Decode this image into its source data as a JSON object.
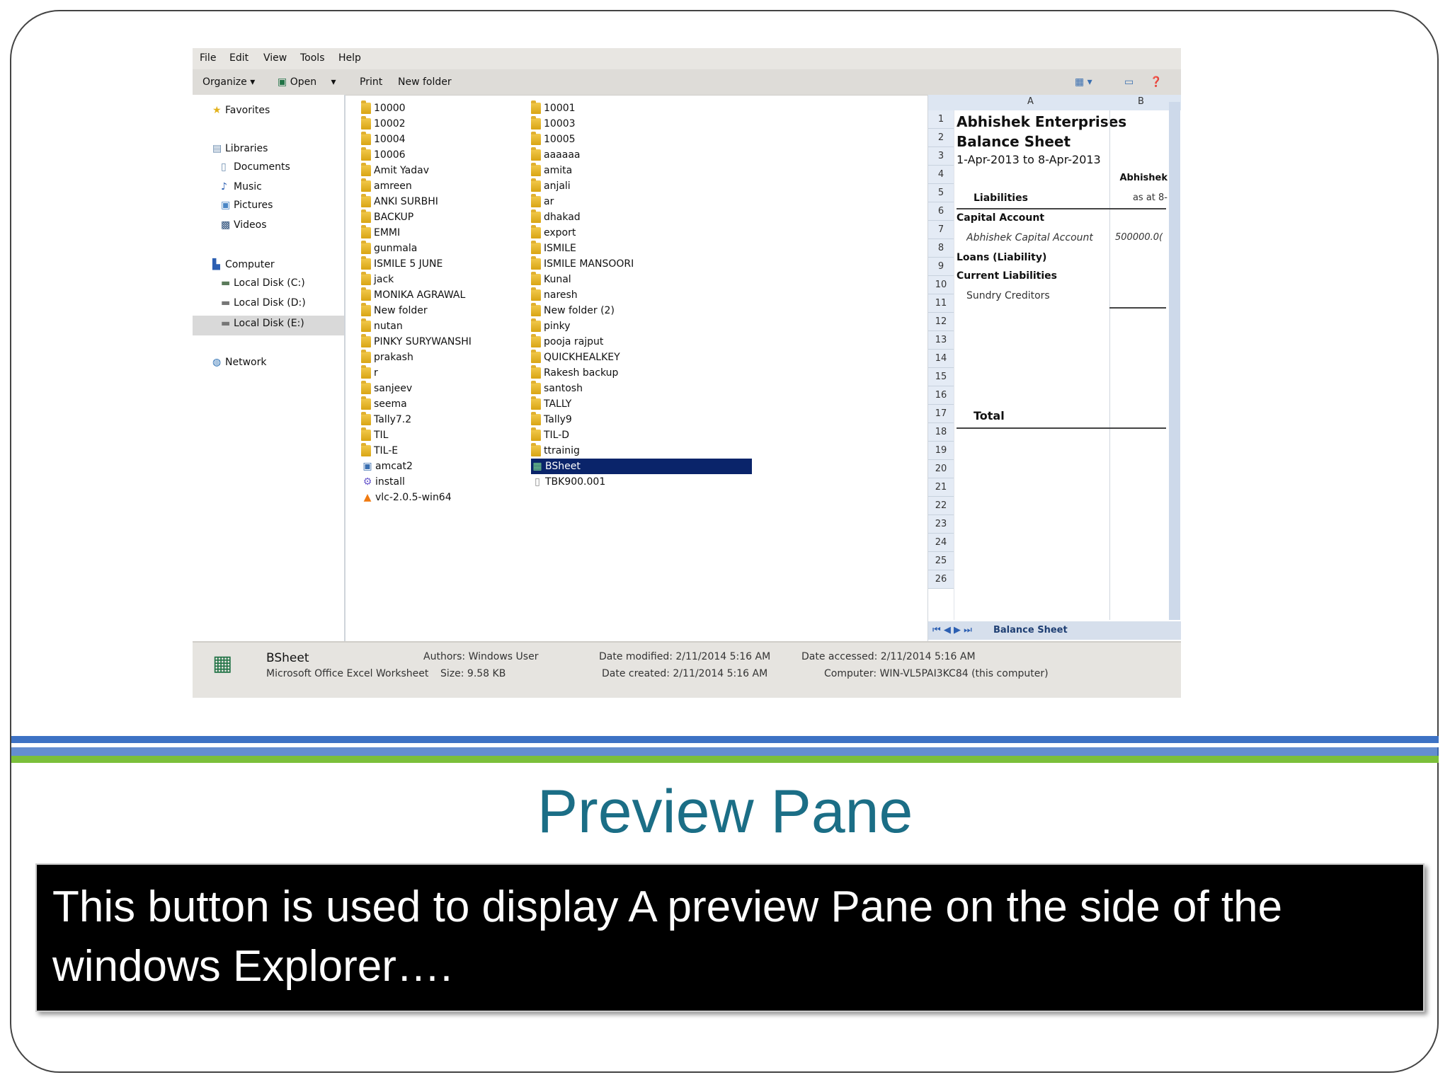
{
  "menu": [
    "File",
    "Edit",
    "View",
    "Tools",
    "Help"
  ],
  "toolbar": {
    "organize": "Organize",
    "open": "Open",
    "print": "Print",
    "new_folder": "New folder"
  },
  "nav": {
    "favorites": "Favorites",
    "libraries": "Libraries",
    "documents": "Documents",
    "music": "Music",
    "pictures": "Pictures",
    "videos": "Videos",
    "computer": "Computer",
    "disk_c": "Local Disk (C:)",
    "disk_d": "Local Disk (D:)",
    "disk_e": "Local Disk (E:)",
    "network": "Network"
  },
  "files": {
    "col1": [
      "10000",
      "10002",
      "10004",
      "10006",
      "Amit Yadav",
      "amreen",
      "ANKI SURBHI",
      "BACKUP",
      "EMMI",
      "gunmala",
      "ISMILE 5 JUNE",
      "jack",
      "MONIKA AGRAWAL",
      "New folder",
      "nutan",
      "PINKY SURYWANSHI",
      "prakash",
      "r",
      "sanjeev",
      "seema",
      "Tally7.2",
      "TIL",
      "TIL-E",
      "amcat2",
      "install",
      "vlc-2.0.5-win64"
    ],
    "col2": [
      "10001",
      "10003",
      "10005",
      "aaaaaa",
      "amita",
      "anjali",
      "ar",
      "dhakad",
      "export",
      "ISMILE",
      "ISMILE MANSOORI",
      "Kunal",
      "naresh",
      "New folder (2)",
      "pinky",
      "pooja rajput",
      "QUICKHEALKEY",
      "Rakesh backup",
      "santosh",
      "TALLY",
      "Tally9",
      "TIL-D",
      "ttrainig",
      "BSheet",
      "TBK900.001"
    ]
  },
  "preview": {
    "col_a": "A",
    "col_b": "B",
    "rows": [
      "1",
      "2",
      "3",
      "4",
      "5",
      "6",
      "7",
      "8",
      "9",
      "10",
      "11",
      "12",
      "13",
      "14",
      "15",
      "16",
      "17",
      "18",
      "19",
      "20",
      "21",
      "22",
      "23",
      "24",
      "25",
      "26"
    ],
    "company": "Abhishek Enterprises",
    "sheet_title": "Balance Sheet",
    "period": "1-Apr-2013 to 8-Apr-2013",
    "b4": "Abhishek",
    "liabilities": "Liabilities",
    "b5": "as at 8-",
    "capital_account": "Capital Account",
    "abhishek_capital": "Abhishek Capital Account",
    "b7": "500000.0(",
    "loans": "Loans (Liability)",
    "current_liabilities": "Current Liabilities",
    "sundry_creditors": "Sundry Creditors",
    "total": "Total",
    "sheet_tab": "Balance Sheet"
  },
  "status": {
    "name": "BSheet",
    "type": "Microsoft Office Excel Worksheet",
    "authors": "Authors: Windows User",
    "size": "Size: 9.58 KB",
    "modified": "Date modified: 2/11/2014 5:16 AM",
    "created": "Date created: 2/11/2014 5:16 AM",
    "accessed": "Date accessed: 2/11/2014 5:16 AM",
    "computer": "Computer: WIN-VL5PAI3KC84 (this computer)"
  },
  "slide": {
    "title": "Preview Pane",
    "caption": "This button is used to display A preview Pane on the side of the windows Explorer…."
  },
  "colors": {
    "title": "#1b6e86",
    "band_blue": "#3d72c4",
    "band_green": "#7bbf3a",
    "selection": "#0a246a"
  }
}
